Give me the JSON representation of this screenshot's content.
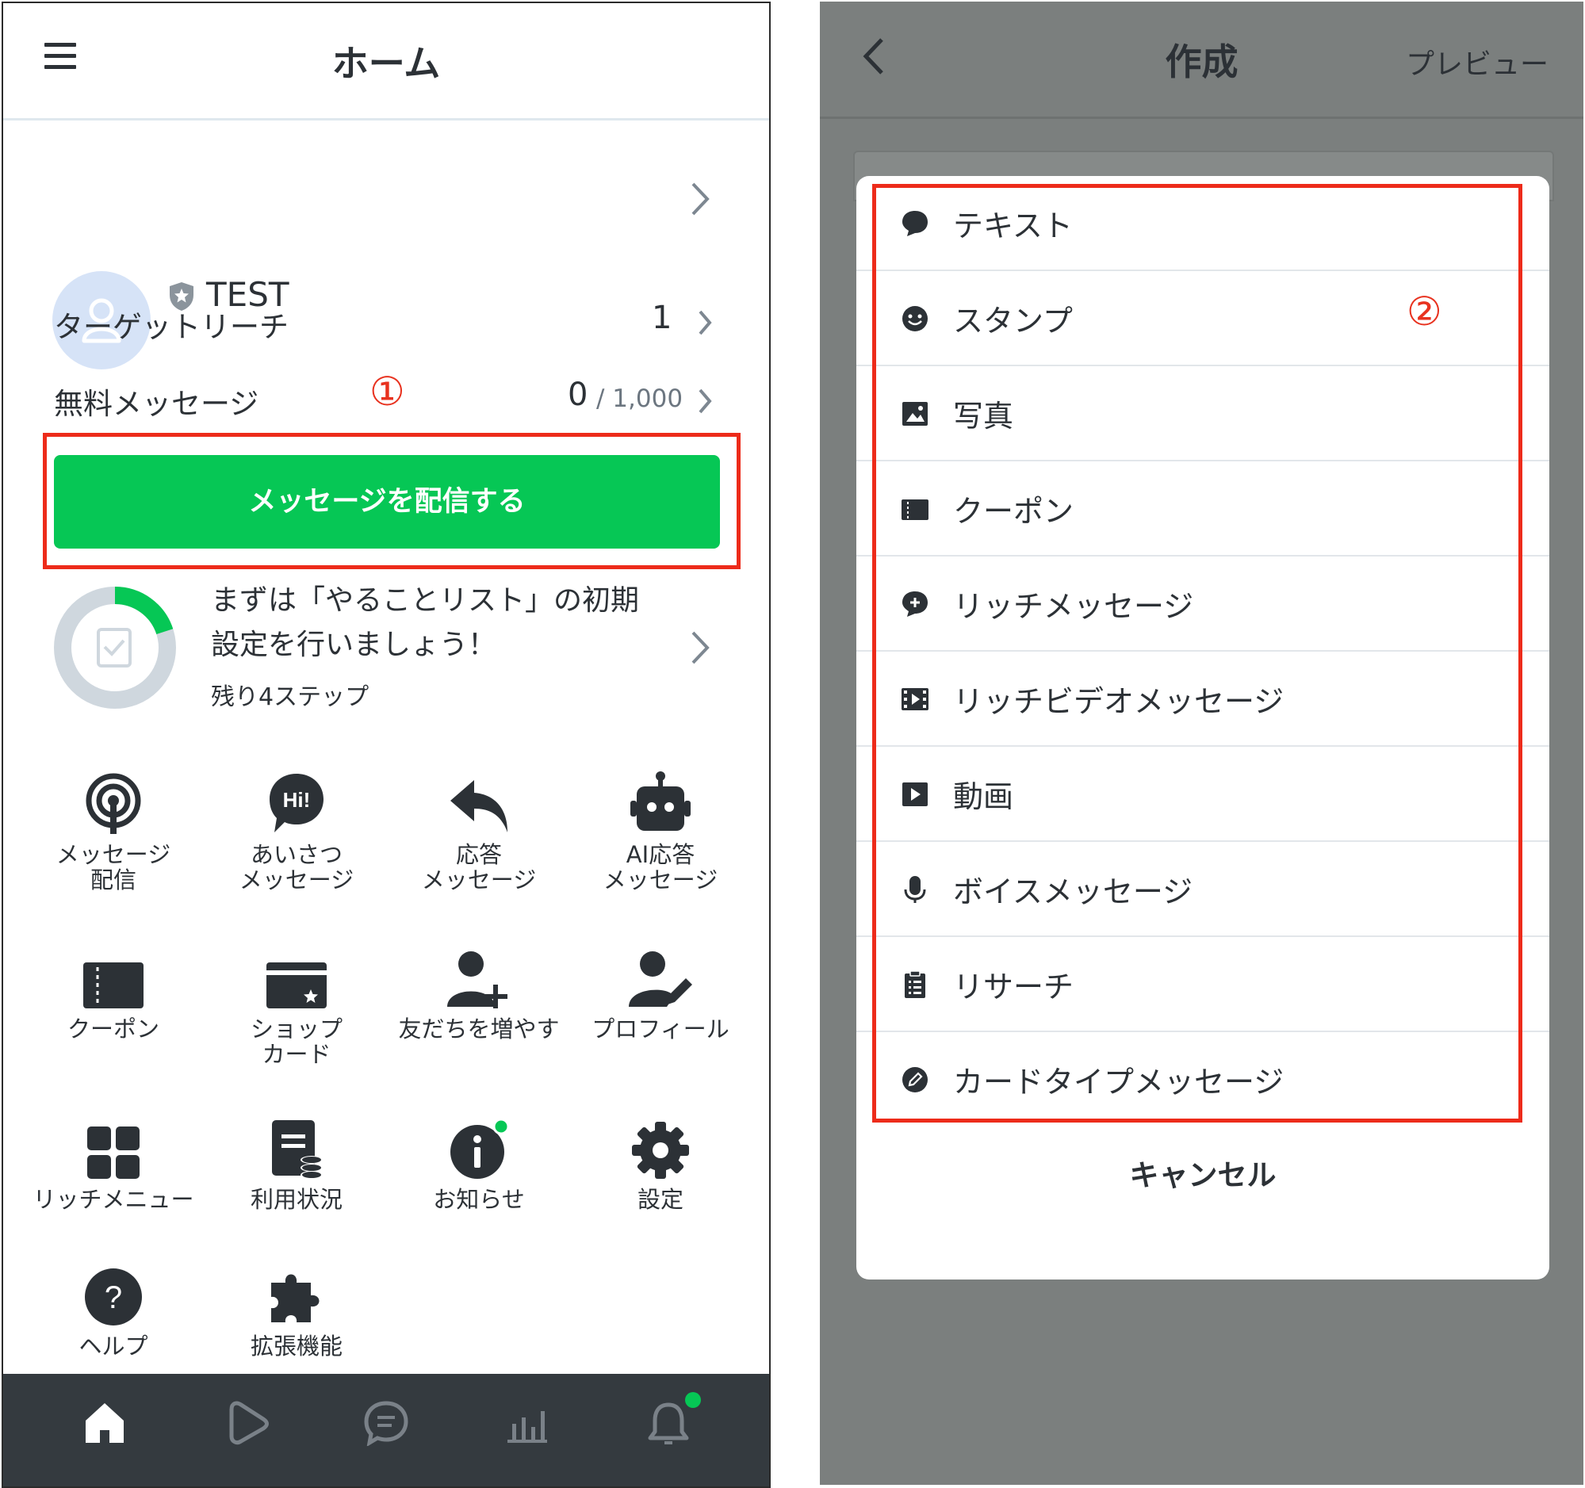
{
  "left": {
    "header": {
      "title": "ホーム",
      "menu_icon": "hamburger-menu-icon"
    },
    "account": {
      "name": "TEST",
      "avatar_icon": "person-icon",
      "badge_icon": "shield-star-icon"
    },
    "target_reach": {
      "label": "ターゲットリーチ",
      "value": "1"
    },
    "free_messages": {
      "label": "無料メッセージ",
      "used": "0",
      "limit": "/ 1,000"
    },
    "annotation_1": "①",
    "send_button": "メッセージを配信する",
    "todo": {
      "line1": "まずは「やることリスト」の初期",
      "line2": "設定を行いましょう！",
      "remaining": "残り4ステップ",
      "progress": 0.2
    },
    "grid": [
      {
        "label": "メッセージ\n配信",
        "icon": "broadcast-icon"
      },
      {
        "label": "あいさつ\nメッセージ",
        "icon": "greeting-hi-icon"
      },
      {
        "label": "応答\nメッセージ",
        "icon": "reply-icon"
      },
      {
        "label": "AI応答\nメッセージ",
        "icon": "robot-icon"
      },
      {
        "label": "クーポン",
        "icon": "coupon-icon"
      },
      {
        "label": "ショップ\nカード",
        "icon": "shop-card-icon"
      },
      {
        "label": "友だちを増やす",
        "icon": "add-friend-icon"
      },
      {
        "label": "プロフィール",
        "icon": "profile-edit-icon"
      },
      {
        "label": "リッチメニュー",
        "icon": "rich-menu-icon"
      },
      {
        "label": "利用状況",
        "icon": "usage-icon"
      },
      {
        "label": "お知らせ",
        "icon": "info-icon"
      },
      {
        "label": "設定",
        "icon": "settings-gear-icon"
      },
      {
        "label": "ヘルプ",
        "icon": "help-icon"
      },
      {
        "label": "拡張機能",
        "icon": "extension-puzzle-icon"
      }
    ],
    "bottom_nav": [
      "home-icon",
      "timeline-icon",
      "chat-icon",
      "analytics-icon",
      "notification-bell-icon"
    ],
    "colors": {
      "accent": "#06c755",
      "highlight": "#ed2b1a",
      "nav_bg": "#343a3f"
    }
  },
  "right": {
    "header": {
      "title": "作成",
      "preview": "プレビュー",
      "back_icon": "back-chevron-icon"
    },
    "annotation_2": "②",
    "options": [
      {
        "label": "テキスト",
        "icon": "text-bubble-icon"
      },
      {
        "label": "スタンプ",
        "icon": "sticker-smile-icon"
      },
      {
        "label": "写真",
        "icon": "photo-icon"
      },
      {
        "label": "クーポン",
        "icon": "coupon-icon"
      },
      {
        "label": "リッチメッセージ",
        "icon": "rich-message-icon"
      },
      {
        "label": "リッチビデオメッセージ",
        "icon": "rich-video-icon"
      },
      {
        "label": "動画",
        "icon": "video-play-icon"
      },
      {
        "label": "ボイスメッセージ",
        "icon": "microphone-icon"
      },
      {
        "label": "リサーチ",
        "icon": "survey-clipboard-icon"
      },
      {
        "label": "カードタイプメッセージ",
        "icon": "card-type-icon"
      }
    ],
    "cancel": "キャンセル"
  }
}
